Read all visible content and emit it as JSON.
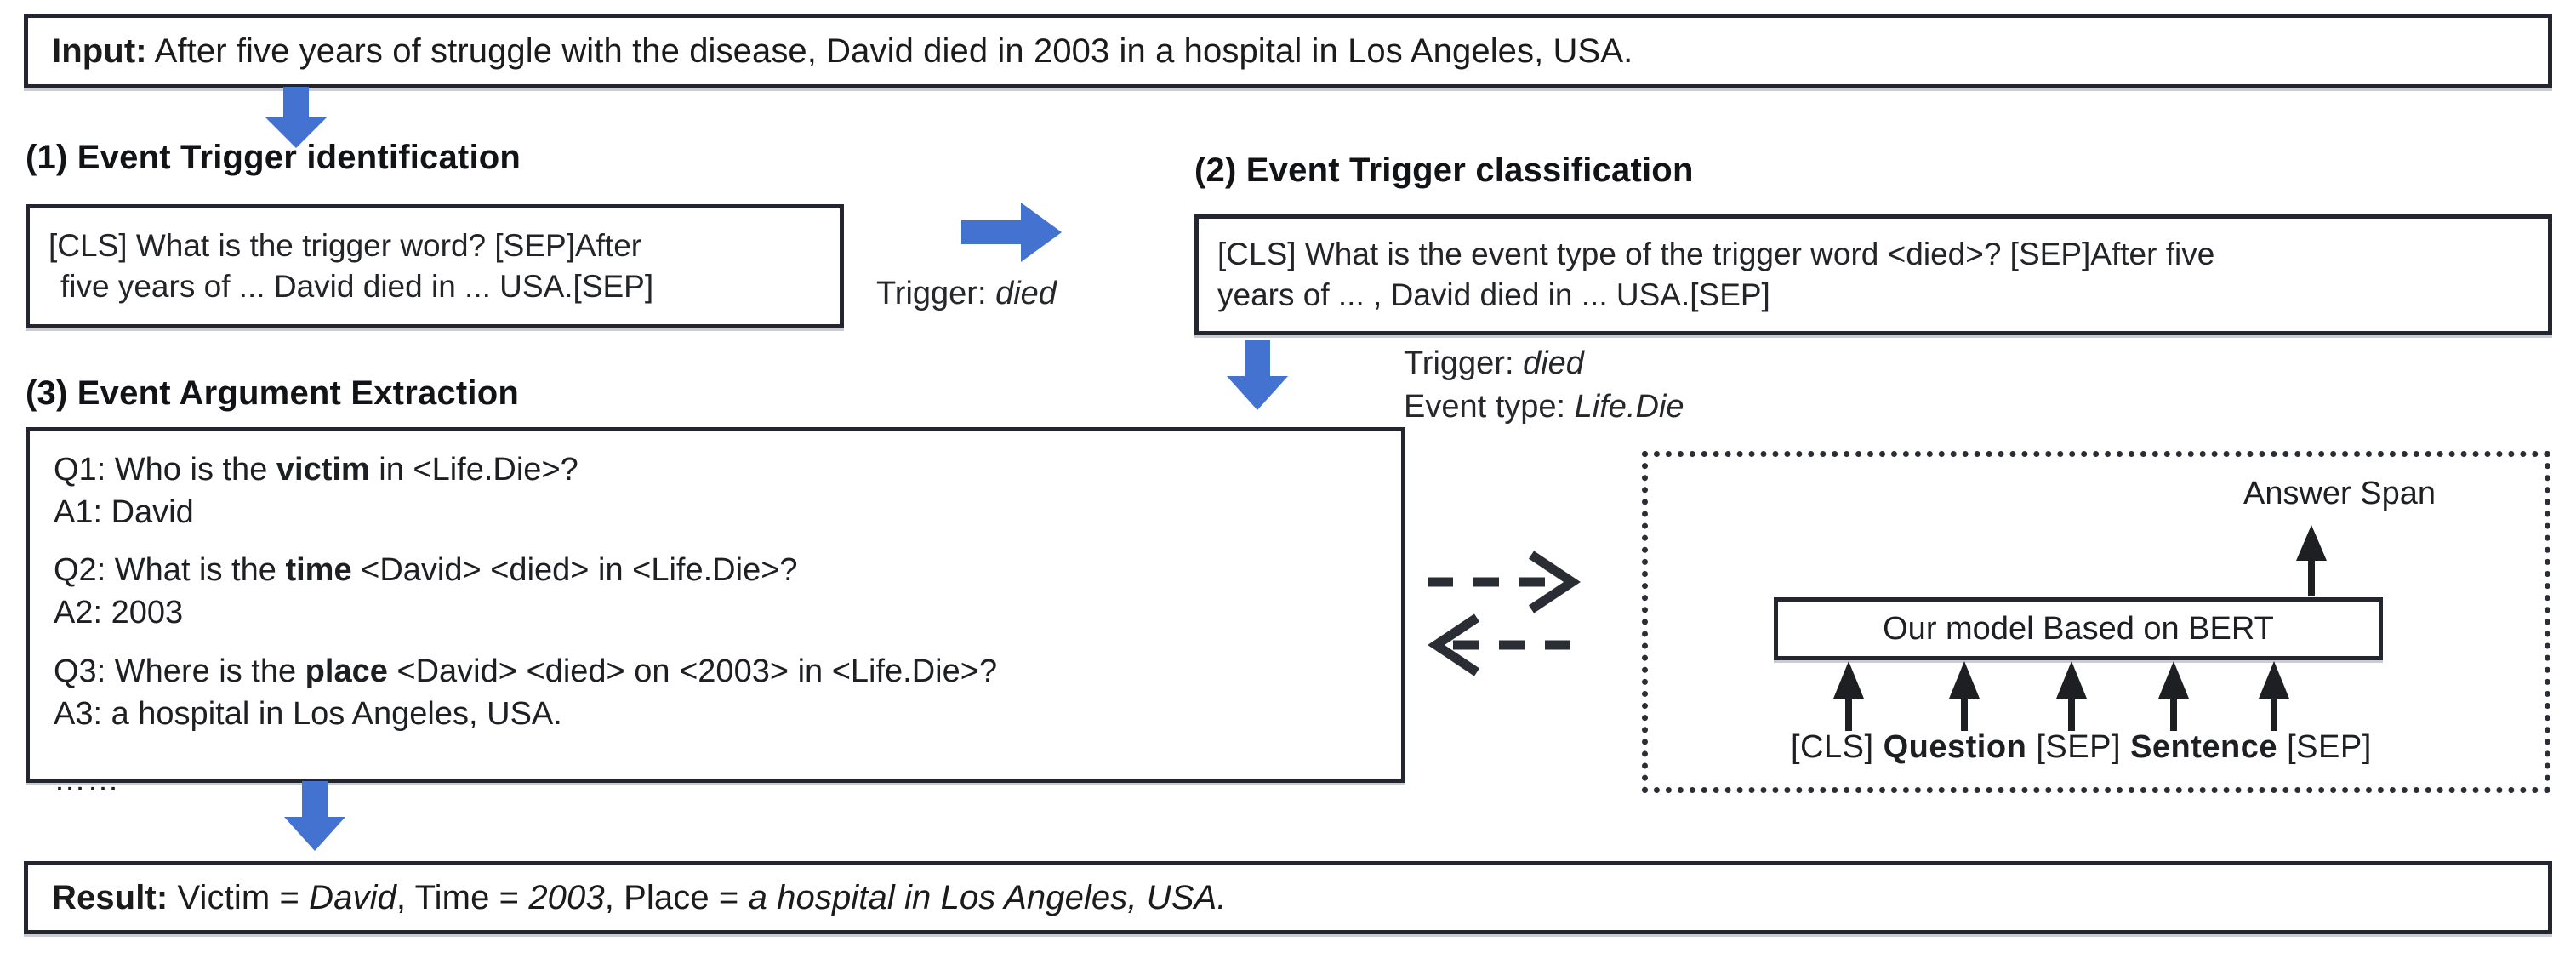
{
  "input_strip": {
    "label": "Input:",
    "text": " After five years of struggle with the disease, David died in 2003 in a hospital in Los Angeles, USA."
  },
  "stage1": {
    "heading": "(1) Event Trigger identification",
    "prompt_line1": "[CLS] What is the trigger word? [SEP]After",
    "prompt_line2": "five years of  ... David died in ... USA.[SEP]"
  },
  "stage2": {
    "heading": "(2) Event Trigger classification",
    "prompt_line1": "[CLS] What is the event type of the trigger word <died>? [SEP]After five",
    "prompt_line2": "years of ... , David died in ... USA.[SEP]"
  },
  "trigger_label": {
    "prefix": "Trigger: ",
    "value": "died"
  },
  "stage2_output": {
    "trigger_prefix": "Trigger: ",
    "trigger_value": "died",
    "event_type_prefix": "Event type: ",
    "event_type_value": "Life.Die"
  },
  "stage3": {
    "heading": "(3) Event Argument Extraction",
    "lines": [
      {
        "prefix": "Q1: Who is the ",
        "bold": "victim",
        "suffix": " in <Life.Die>?"
      },
      {
        "prefix": "A1: David",
        "bold": "",
        "suffix": ""
      },
      {
        "prefix": "Q2: What is the ",
        "bold": "time",
        "suffix": " <David> <died> in <Life.Die>?"
      },
      {
        "prefix": "A2: 2003",
        "bold": "",
        "suffix": ""
      },
      {
        "prefix": "Q3: Where is the ",
        "bold": "place",
        "suffix": " <David> <died> on <2003> in <Life.Die>?"
      },
      {
        "prefix": "A3: a hospital in Los Angeles, USA.",
        "bold": "",
        "suffix": ""
      }
    ],
    "ellipsis": "……"
  },
  "model_panel": {
    "answer_span": "Answer Span",
    "model_label": "Our model Based on BERT",
    "tokens": [
      {
        "text": "[CLS] ",
        "bold": false
      },
      {
        "text": "Question",
        "bold": true
      },
      {
        "text": " [SEP] ",
        "bold": false
      },
      {
        "text": "Sentence",
        "bold": true
      },
      {
        "text": " [SEP]",
        "bold": false
      }
    ]
  },
  "result_strip": {
    "label": "Result:",
    "victim_key": " Victim = ",
    "victim_value": "David",
    "time_key": ",  Time = ",
    "time_value": "2003",
    "place_key": ",  Place = ",
    "place_value": "a hospital in Los Angeles, USA."
  },
  "colors": {
    "arrow_blue": "#4472d0",
    "box_border": "#23262e",
    "box_shadow": "#c9ccd2",
    "text": "#1d1f23"
  }
}
